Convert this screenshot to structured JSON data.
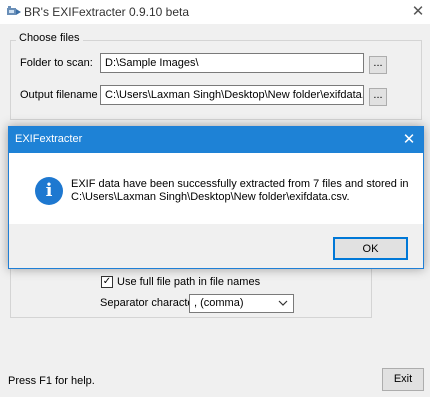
{
  "window": {
    "title": "BR's EXIFextracter 0.9.10 beta",
    "close_glyph": "✕"
  },
  "choose_files": {
    "group_label": "Choose files",
    "folder_label": "Folder to scan:",
    "folder_value": "D:\\Sample Images\\",
    "output_label": "Output filename :",
    "output_value": "C:\\Users\\Laxman Singh\\Desktop\\New folder\\exifdata.csv",
    "browse_label": "..."
  },
  "options": {
    "full_path_label": "Use full file path in file names",
    "full_path_checked": true,
    "separator_label": "Separator character:",
    "separator_value": ", (comma)"
  },
  "dialog": {
    "title": "EXIFextracter",
    "close_glyph": "✕",
    "message_line1": "EXIF data have been successfully extracted from 7 files and stored in",
    "message_line2": "C:\\Users\\Laxman Singh\\Desktop\\New folder\\exifdata.csv.",
    "ok_label": "OK"
  },
  "footer": {
    "help_text": "Press F1 for help.",
    "exit_label": "Exit"
  }
}
